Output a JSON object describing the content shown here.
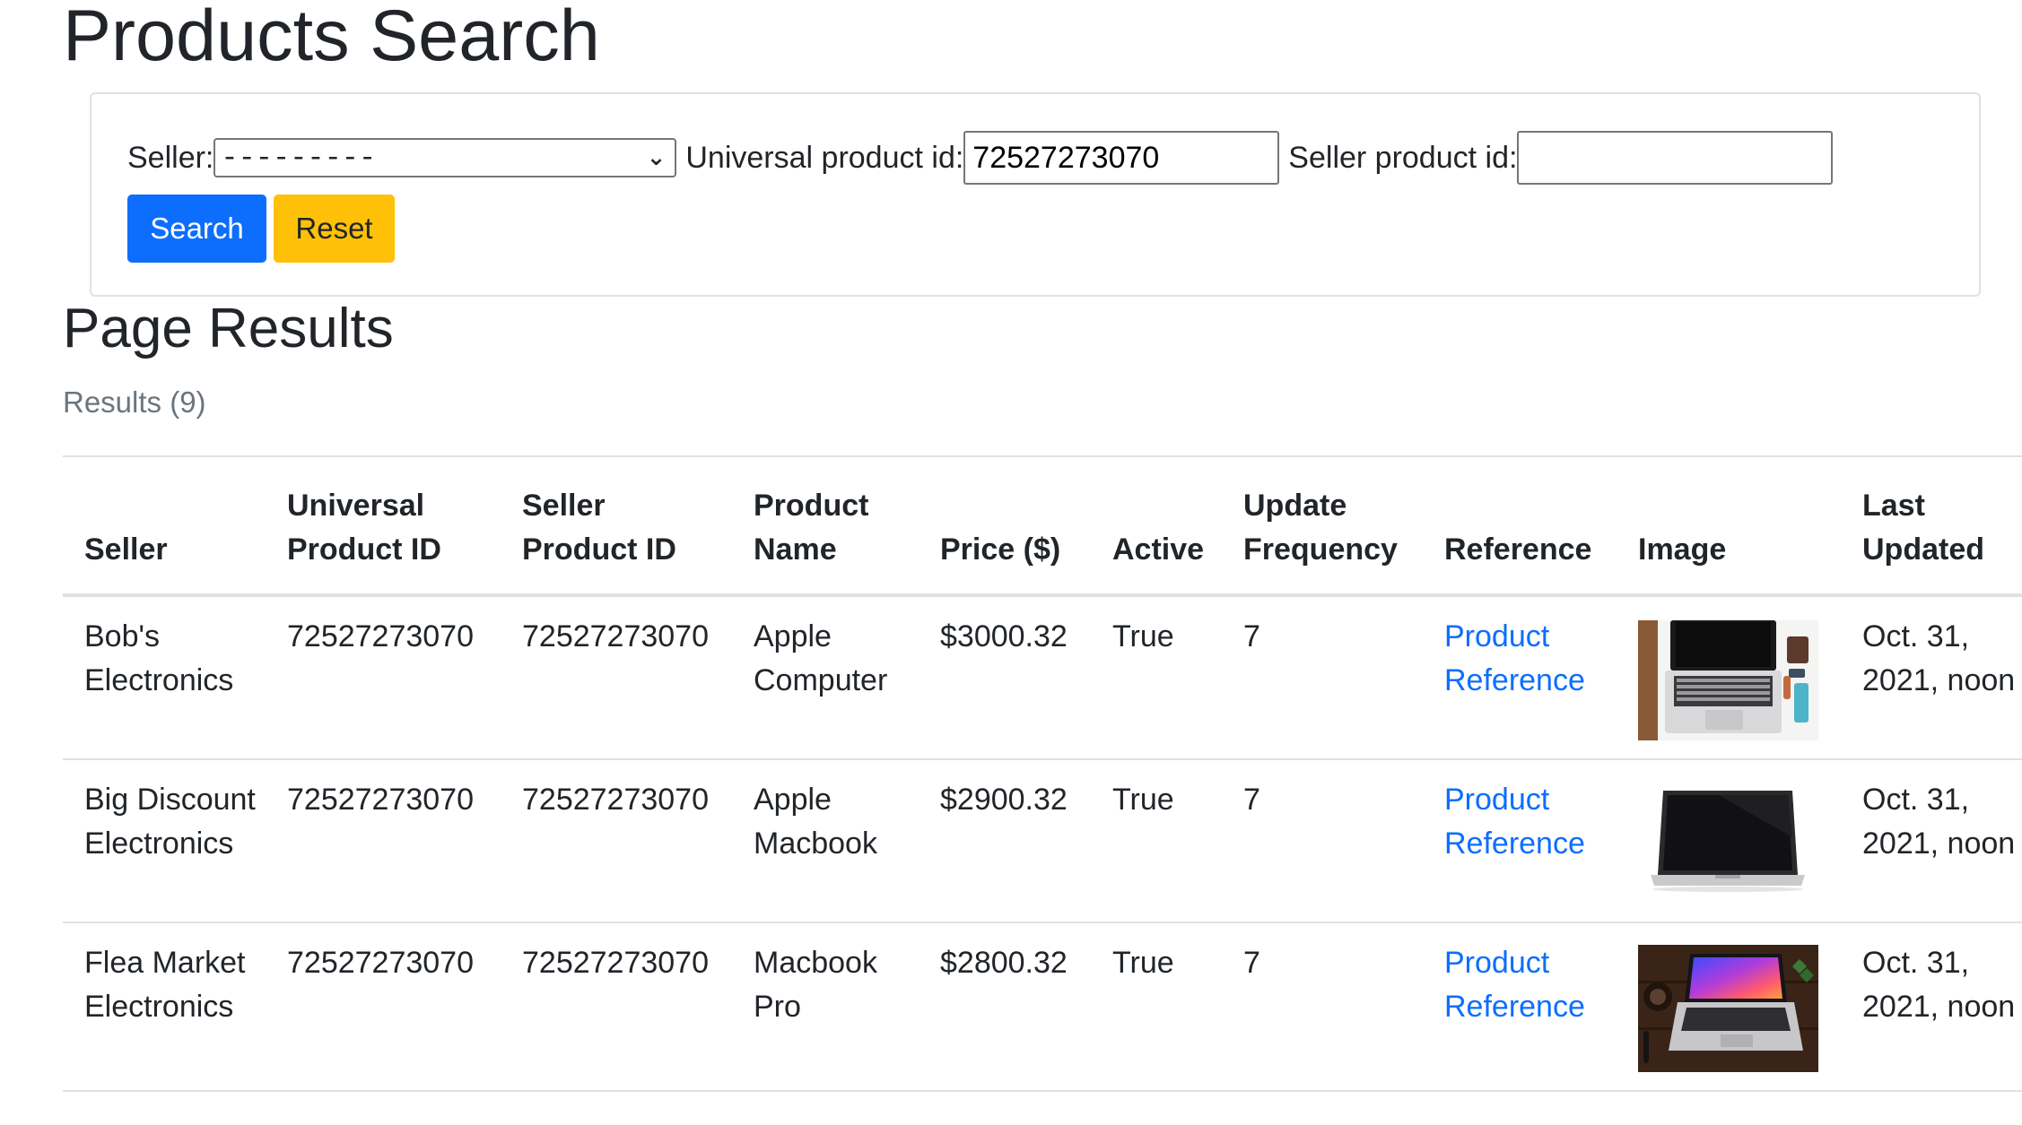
{
  "page": {
    "title": "Products Search"
  },
  "search_form": {
    "seller_label": "Seller:",
    "seller_selected": "---------",
    "upid_label": "Universal product id:",
    "upid_value": "72527273070",
    "spid_label": "Seller product id:",
    "spid_value": "",
    "search_button": "Search",
    "reset_button": "Reset"
  },
  "results": {
    "title": "Page Results",
    "count_text": "Results (9)",
    "headers": {
      "seller": "Seller",
      "upid_1": "Universal",
      "upid_2": "Product ID",
      "spid_1": "Seller",
      "spid_2": "Product ID",
      "name_1": "Product",
      "name_2": "Name",
      "price": "Price ($)",
      "active": "Active",
      "freq_1": "Update",
      "freq_2": "Frequency",
      "reference": "Reference",
      "image": "Image",
      "updated_1": "Last",
      "updated_2": "Updated"
    },
    "rows": [
      {
        "seller": "Bob's Electronics",
        "upid": "72527273070",
        "spid": "72527273070",
        "name": "Apple Computer",
        "price": "$3000.32",
        "active": "True",
        "frequency": "7",
        "reference": "Product Reference",
        "updated": "Oct. 31, 2021, noon"
      },
      {
        "seller": "Big Discount Electronics",
        "upid": "72527273070",
        "spid": "72527273070",
        "name": "Apple Macbook",
        "price": "$2900.32",
        "active": "True",
        "frequency": "7",
        "reference": "Product Reference",
        "updated": "Oct. 31, 2021, noon"
      },
      {
        "seller": "Flea Market Electronics",
        "upid": "72527273070",
        "spid": "72527273070",
        "name": "Macbook Pro",
        "price": "$2800.32",
        "active": "True",
        "frequency": "7",
        "reference": "Product Reference",
        "updated": "Oct. 31, 2021, noon"
      }
    ]
  },
  "colors": {
    "primary": "#0d6efd",
    "warning": "#ffc107",
    "muted": "#6c757d",
    "border": "#dee2e6"
  }
}
